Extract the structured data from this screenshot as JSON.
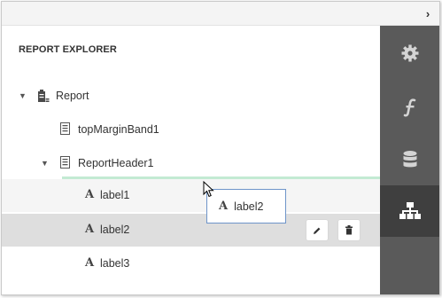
{
  "collapse_glyph": "›",
  "panel": {
    "title": "REPORT EXPLORER"
  },
  "tree": {
    "report": {
      "label": "Report",
      "expanded": true,
      "icon": "clipboard-report-icon"
    },
    "top_margin": {
      "label": "topMarginBand1",
      "icon": "band-icon"
    },
    "report_header": {
      "label": "ReportHeader1",
      "expanded": true,
      "icon": "band-icon"
    },
    "label1": {
      "label": "label1",
      "glyph": "A"
    },
    "label2": {
      "label": "label2",
      "glyph": "A"
    },
    "label3": {
      "label": "label3",
      "glyph": "A"
    }
  },
  "drag_ghost": {
    "glyph": "A",
    "label": "label2"
  },
  "rail_tabs": [
    {
      "name": "properties-tab",
      "icon": "gear-icon"
    },
    {
      "name": "expressions-tab",
      "icon": "function-icon"
    },
    {
      "name": "field-list-tab",
      "icon": "database-icon"
    },
    {
      "name": "report-explorer-tab",
      "icon": "hierarchy-icon",
      "active": true
    }
  ],
  "colors": {
    "rail": "#5a5a5a",
    "rail_active": "#3f3f3f",
    "selected_row": "#dedede",
    "drop_indicator": "#c3ead3",
    "ghost_border": "#6e94c9"
  }
}
